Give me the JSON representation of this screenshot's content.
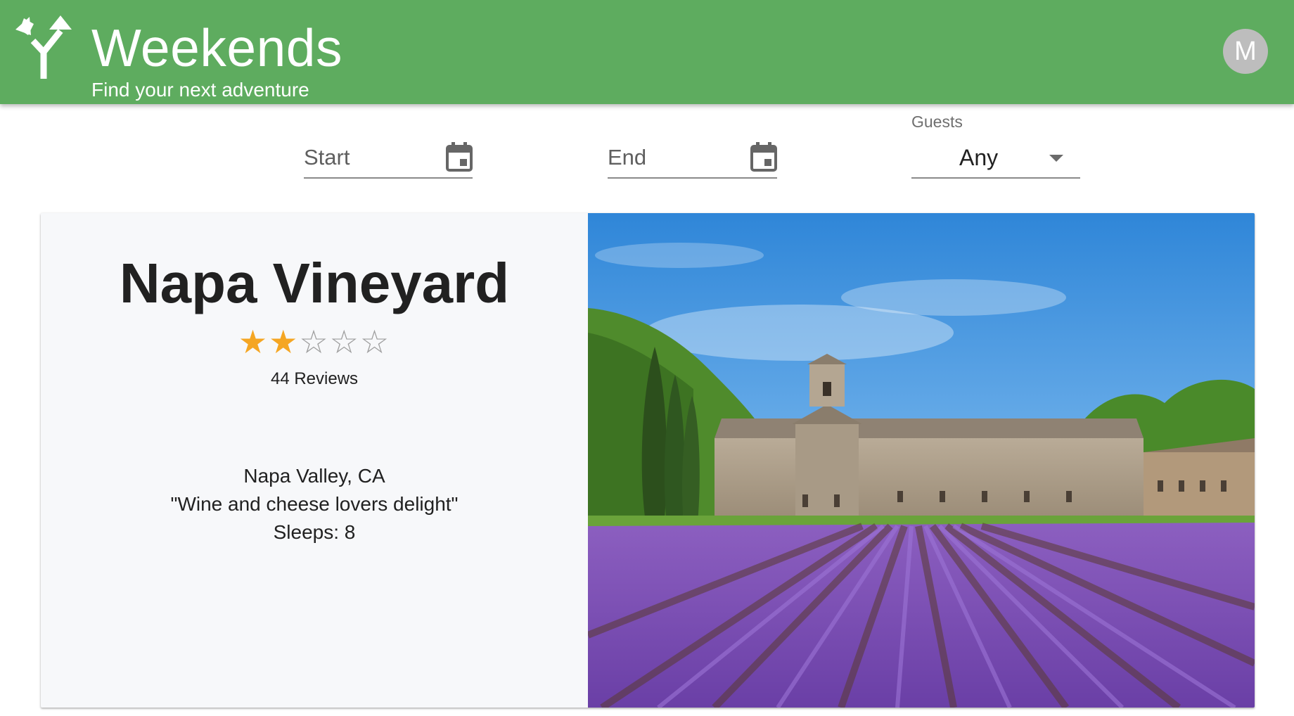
{
  "app": {
    "title": "Weekends",
    "subtitle": "Find your next adventure",
    "logo_icon": "fork-arrows-icon",
    "avatar_initial": "M",
    "brand_color": "#5eac5f"
  },
  "filters": {
    "start": {
      "placeholder": "Start",
      "icon": "calendar-icon"
    },
    "end": {
      "placeholder": "End",
      "icon": "calendar-icon"
    },
    "guests": {
      "label": "Guests",
      "value": "Any",
      "icon": "dropdown-caret-icon"
    }
  },
  "listing": {
    "title": "Napa Vineyard",
    "rating": 2,
    "rating_max": 5,
    "reviews": "44 Reviews",
    "location": "Napa Valley, CA",
    "tagline": "\"Wine and cheese lovers delight\"",
    "sleeps": "Sleeps: 8",
    "star_color": "#f5a623",
    "image": "abbey-and-lavender-field-photo"
  }
}
